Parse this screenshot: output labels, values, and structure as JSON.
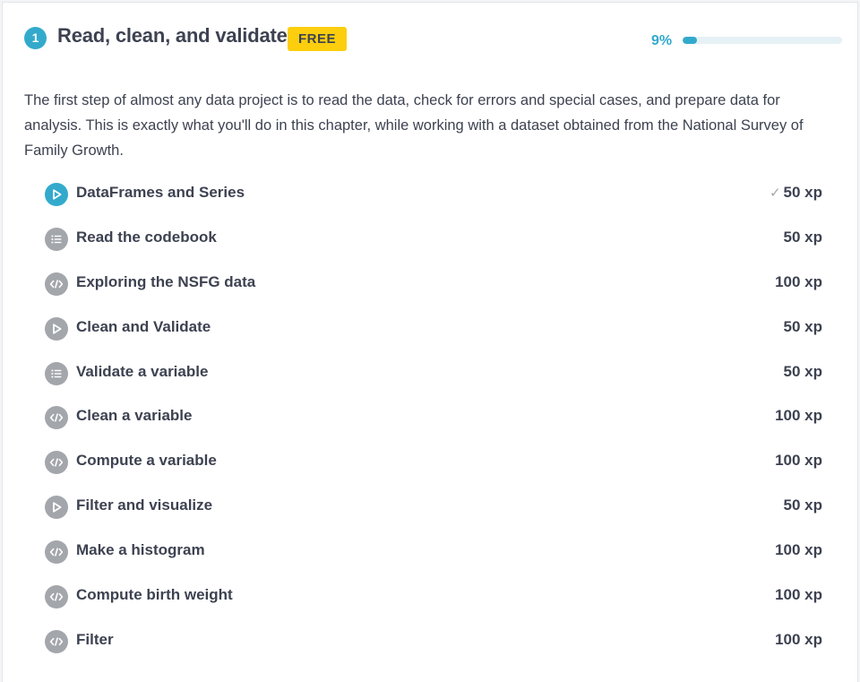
{
  "chapter": {
    "number": "1",
    "title": "Read, clean, and validate",
    "badge": "FREE",
    "progress_label": "9%",
    "progress_fraction": 0.09,
    "description": "The first step of almost any data project is to read the data, check for errors and special cases, and prepare data for analysis. This is exactly what you'll do in this chapter, while working with a dataset obtained from the National Survey of Family Growth."
  },
  "colors": {
    "accent": "#33aacc",
    "badge_yellow": "#fcce0d",
    "icon_gray": "#a3a6ab",
    "text_dark": "#3d4251"
  },
  "exercises": [
    {
      "title": "DataFrames and Series",
      "xp": "50 xp",
      "icon": "video-play-icon",
      "type": "video",
      "active": true,
      "completed": true
    },
    {
      "title": "Read the codebook",
      "xp": "50 xp",
      "icon": "list-icon",
      "type": "multiple-choice",
      "active": false,
      "completed": false
    },
    {
      "title": "Exploring the NSFG data",
      "xp": "100 xp",
      "icon": "code-icon",
      "type": "code",
      "active": false,
      "completed": false
    },
    {
      "title": "Clean and Validate",
      "xp": "50 xp",
      "icon": "video-play-icon",
      "type": "video",
      "active": false,
      "completed": false
    },
    {
      "title": "Validate a variable",
      "xp": "50 xp",
      "icon": "list-icon",
      "type": "multiple-choice",
      "active": false,
      "completed": false
    },
    {
      "title": "Clean a variable",
      "xp": "100 xp",
      "icon": "code-icon",
      "type": "code",
      "active": false,
      "completed": false
    },
    {
      "title": "Compute a variable",
      "xp": "100 xp",
      "icon": "code-icon",
      "type": "code",
      "active": false,
      "completed": false
    },
    {
      "title": "Filter and visualize",
      "xp": "50 xp",
      "icon": "video-play-icon",
      "type": "video",
      "active": false,
      "completed": false
    },
    {
      "title": "Make a histogram",
      "xp": "100 xp",
      "icon": "code-icon",
      "type": "code",
      "active": false,
      "completed": false
    },
    {
      "title": "Compute birth weight",
      "xp": "100 xp",
      "icon": "code-icon",
      "type": "code",
      "active": false,
      "completed": false
    },
    {
      "title": "Filter",
      "xp": "100 xp",
      "icon": "code-icon",
      "type": "code",
      "active": false,
      "completed": false
    }
  ]
}
